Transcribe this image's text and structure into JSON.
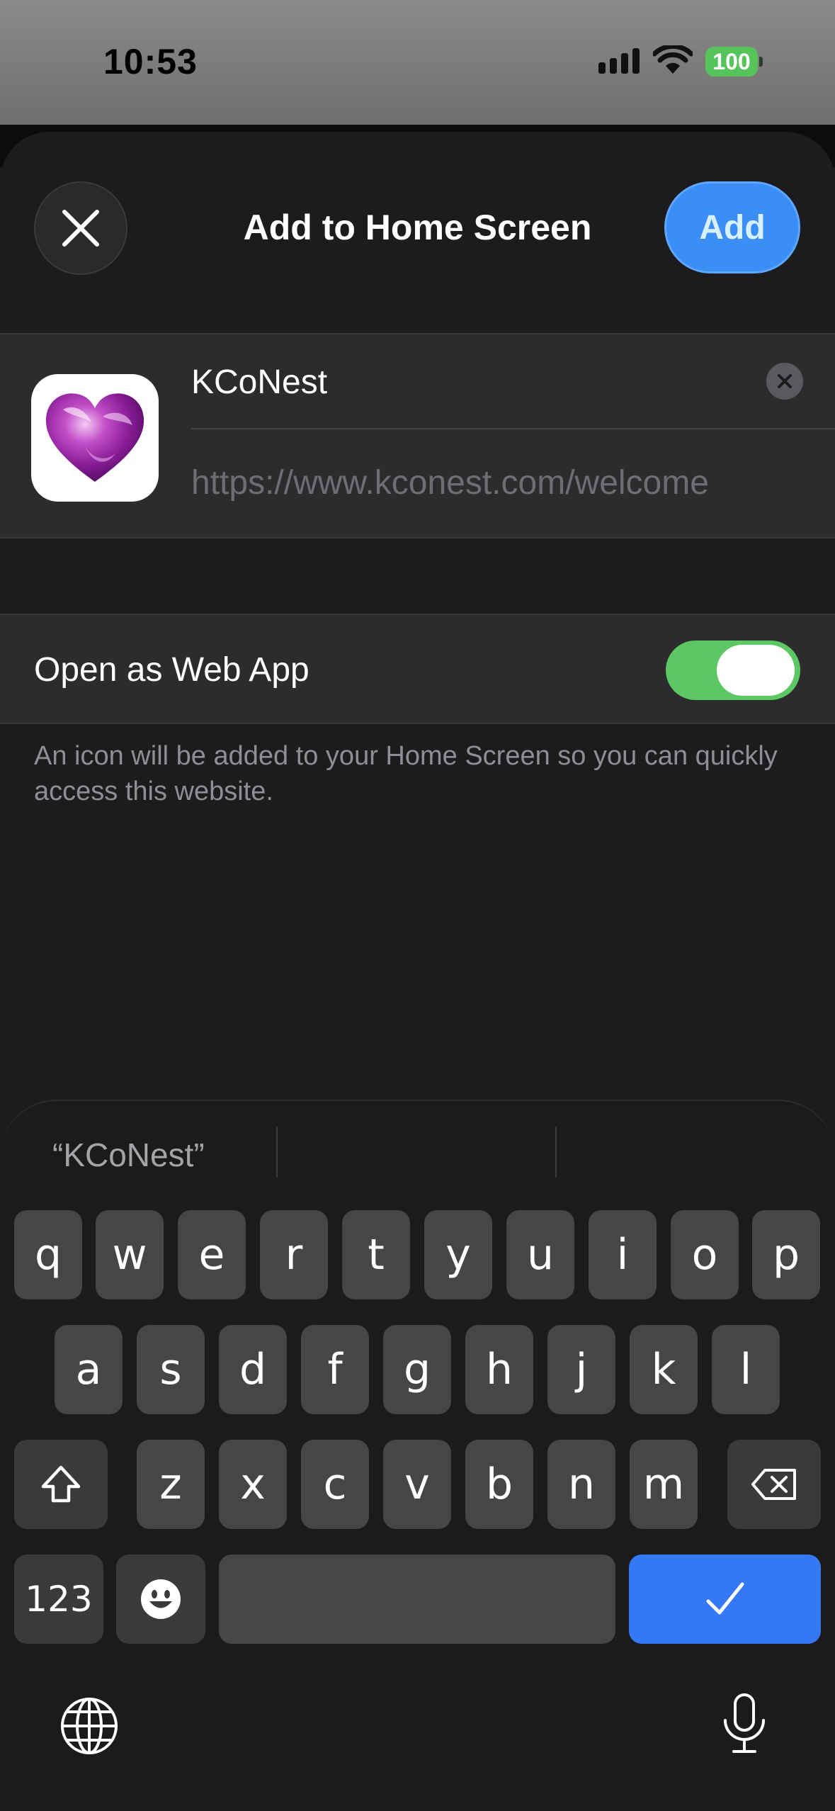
{
  "status_bar": {
    "time": "10:53",
    "battery": "100"
  },
  "sheet": {
    "title": "Add to Home Screen",
    "add_label": "Add"
  },
  "bookmark": {
    "name_value": "KCoNest",
    "url": "https://www.kconest.com/welcome"
  },
  "web_app": {
    "label": "Open as Web App",
    "enabled": true,
    "footnote": "An icon will be added to your Home Screen so you can quickly access this website."
  },
  "keyboard": {
    "suggestions": [
      "“KCoNest”",
      "",
      ""
    ],
    "row1": [
      "q",
      "w",
      "e",
      "r",
      "t",
      "y",
      "u",
      "i",
      "o",
      "p"
    ],
    "row2": [
      "a",
      "s",
      "d",
      "f",
      "g",
      "h",
      "j",
      "k",
      "l"
    ],
    "row3": [
      "z",
      "x",
      "c",
      "v",
      "b",
      "n",
      "m"
    ],
    "numbers_label": "123"
  },
  "colors": {
    "accent": "#3b8ef5",
    "toggle_on": "#5dc763",
    "return_key": "#3478f6"
  }
}
